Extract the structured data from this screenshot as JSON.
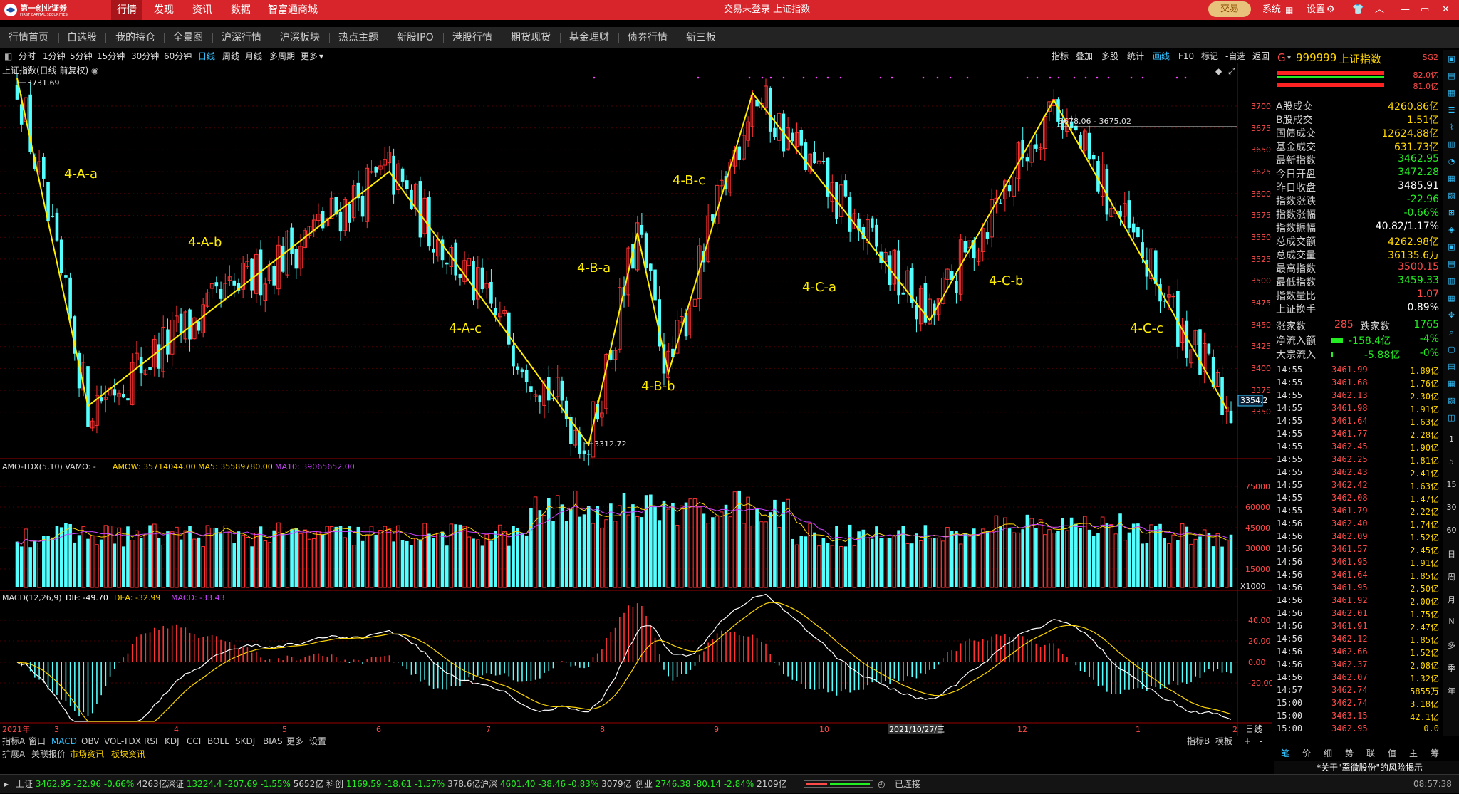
{
  "app": {
    "logo_text": "第一创业证券",
    "logo_sub": "FIRST CAPITAL SECURITIES",
    "menu": [
      "行情",
      "发现",
      "资讯",
      "数据",
      "智富通商城"
    ],
    "active_menu": "行情",
    "title": "交易未登录   上证指数",
    "trade_btn": "交易",
    "right_menu": [
      "系统",
      "设置"
    ]
  },
  "nav": [
    "行情首页",
    "自选股",
    "我的持仓",
    "全景图",
    "沪深行情",
    "沪深板块",
    "热点主题",
    "新股IPO",
    "港股行情",
    "期货现货",
    "基金理财",
    "债券行情",
    "新三板"
  ],
  "periods": [
    "分时",
    "1分钟",
    "5分钟",
    "15分钟",
    "30分钟",
    "60分钟",
    "日线",
    "周线",
    "月线",
    "多周期",
    "更多"
  ],
  "active_period": "日线",
  "tools": [
    "指标",
    "叠加",
    "多股",
    "统计",
    "画线",
    "F10",
    "标记",
    "-自选",
    "返回"
  ],
  "active_tool": "画线",
  "chart_title": "上证指数(日线 前复权)",
  "price_axis": [
    "3700",
    "3675",
    "3650",
    "3625",
    "3600",
    "3575",
    "3550",
    "3525",
    "3500",
    "3475",
    "3450",
    "3425",
    "3400",
    "3375",
    "3350"
  ],
  "annotations": {
    "high_label": "3731.69",
    "low_label": "3312.72",
    "ray_label": "3678.06 - 3675.02",
    "last_label": "3354.2"
  },
  "waves": [
    "4-A-a",
    "4-A-b",
    "4-A-c",
    "4-B-a",
    "4-B-b",
    "4-B-c",
    "4-C-a",
    "4-C-b",
    "4-C-c"
  ],
  "vol_header": {
    "name": "AMO-TDX(5,10) VAMO: -",
    "amow": "AMOW: 35714044.00",
    "ma5": "MA5: 35589780.00",
    "ma10": "MA10: 39065652.00"
  },
  "vol_axis": [
    "75000",
    "60000",
    "45000",
    "30000",
    "15000"
  ],
  "vol_unit": "X1000",
  "macd_header": {
    "name": "MACD(12,26,9)",
    "dif": "DIF: -49.70",
    "dea": "DEA: -32.99",
    "macd": "MACD: -33.43"
  },
  "macd_axis": [
    "40.00",
    "20.00",
    "0.00",
    "-20.00"
  ],
  "time_axis": [
    "2021年",
    "3",
    "4",
    "5",
    "6",
    "7",
    "8",
    "9",
    "10",
    "2021/10/27/三",
    "12",
    "1",
    "2"
  ],
  "cycle": "日线",
  "indicator_tabs": [
    "指标A",
    "窗口",
    "MACD",
    "OBV",
    "VOL-TDX",
    "RSI",
    "KDJ",
    "CCI",
    "BOLL",
    "SKDJ",
    "BIAS",
    "更多",
    "设置"
  ],
  "active_indicator": "MACD",
  "ext_tabs": [
    "扩展A",
    "关联报价",
    "市场资讯",
    "板块资讯"
  ],
  "bottom_right_tabs": [
    "指标B",
    "模板",
    "+",
    "-"
  ],
  "rpanel": {
    "code": "999999",
    "name": "上证指数",
    "flag": "SG2",
    "bars": [
      "82.0亿",
      "81.0亿"
    ],
    "rows": [
      {
        "label": "A股成交",
        "value": "4260.86亿",
        "color": "#ffd700"
      },
      {
        "label": "B股成交",
        "value": "1.51亿",
        "color": "#ffd700"
      },
      {
        "label": "国债成交",
        "value": "12624.88亿",
        "color": "#ffd700"
      },
      {
        "label": "基金成交",
        "value": "631.73亿",
        "color": "#ffd700"
      },
      {
        "label": "最新指数",
        "value": "3462.95",
        "color": "#22ee22"
      },
      {
        "label": "今日开盘",
        "value": "3472.28",
        "color": "#22ee22"
      },
      {
        "label": "昨日收盘",
        "value": "3485.91",
        "color": "#ffffff"
      },
      {
        "label": "指数涨跌",
        "value": "-22.96",
        "color": "#22ee22"
      },
      {
        "label": "指数涨幅",
        "value": "-0.66%",
        "color": "#22ee22"
      },
      {
        "label": "指数振幅",
        "value": "40.82/1.17%",
        "color": "#ffffff"
      },
      {
        "label": "总成交额",
        "value": "4262.98亿",
        "color": "#ffd700"
      },
      {
        "label": "总成交量",
        "value": "36135.6万",
        "color": "#ffd700"
      },
      {
        "label": "最高指数",
        "value": "3500.15",
        "color": "#ff4a4a"
      },
      {
        "label": "最低指数",
        "value": "3459.33",
        "color": "#22ee22"
      },
      {
        "label": "指数量比",
        "value": "1.07",
        "color": "#ff4a4a"
      },
      {
        "label": "上证换手",
        "value": "0.89%",
        "color": "#ffffff"
      }
    ],
    "up_label": "涨家数",
    "up_count": "285",
    "down_label": "跌家数",
    "down_count": "1765",
    "inflow_label": "净流入额",
    "inflow_value": "-158.4亿",
    "inflow_pct": "-4%",
    "block_label": "大宗流入",
    "block_value": "-5.88亿",
    "block_pct": "-0%",
    "ticks": [
      {
        "t": "14:55",
        "p": "3461.99",
        "v": "1.89亿"
      },
      {
        "t": "14:55",
        "p": "3461.68",
        "v": "1.76亿"
      },
      {
        "t": "14:55",
        "p": "3462.13",
        "v": "2.30亿"
      },
      {
        "t": "14:55",
        "p": "3461.98",
        "v": "1.91亿"
      },
      {
        "t": "14:55",
        "p": "3461.64",
        "v": "1.63亿"
      },
      {
        "t": "14:55",
        "p": "3461.77",
        "v": "2.28亿"
      },
      {
        "t": "14:55",
        "p": "3462.45",
        "v": "1.90亿"
      },
      {
        "t": "14:55",
        "p": "3462.25",
        "v": "1.81亿"
      },
      {
        "t": "14:55",
        "p": "3462.43",
        "v": "2.41亿"
      },
      {
        "t": "14:55",
        "p": "3462.42",
        "v": "1.63亿"
      },
      {
        "t": "14:55",
        "p": "3462.08",
        "v": "1.47亿"
      },
      {
        "t": "14:55",
        "p": "3461.79",
        "v": "2.22亿"
      },
      {
        "t": "14:56",
        "p": "3462.40",
        "v": "1.74亿"
      },
      {
        "t": "14:56",
        "p": "3462.09",
        "v": "1.52亿"
      },
      {
        "t": "14:56",
        "p": "3461.57",
        "v": "2.45亿"
      },
      {
        "t": "14:56",
        "p": "3461.95",
        "v": "1.91亿"
      },
      {
        "t": "14:56",
        "p": "3461.64",
        "v": "1.85亿"
      },
      {
        "t": "14:56",
        "p": "3461.95",
        "v": "2.50亿"
      },
      {
        "t": "14:56",
        "p": "3461.92",
        "v": "2.00亿"
      },
      {
        "t": "14:56",
        "p": "3462.01",
        "v": "1.75亿"
      },
      {
        "t": "14:56",
        "p": "3461.91",
        "v": "2.47亿"
      },
      {
        "t": "14:56",
        "p": "3462.12",
        "v": "1.85亿"
      },
      {
        "t": "14:56",
        "p": "3462.66",
        "v": "1.52亿"
      },
      {
        "t": "14:56",
        "p": "3462.37",
        "v": "2.08亿"
      },
      {
        "t": "14:56",
        "p": "3462.07",
        "v": "1.32亿"
      },
      {
        "t": "14:57",
        "p": "3462.74",
        "v": "5855万"
      },
      {
        "t": "15:00",
        "p": "3462.74",
        "v": "3.18亿"
      },
      {
        "t": "15:00",
        "p": "3463.15",
        "v": "42.1亿"
      },
      {
        "t": "15:00",
        "p": "3462.95",
        "v": "0.0"
      }
    ],
    "tabs": [
      "笔",
      "价",
      "细",
      "势",
      "联",
      "值",
      "主",
      "筹"
    ],
    "notice": "*关于\"翠微股份\"的风险揭示"
  },
  "vstrip": [
    "1",
    "5",
    "15",
    "30",
    "60",
    "日",
    "周",
    "月",
    "N",
    "多",
    "季",
    "年"
  ],
  "status": [
    {
      "name": "上证",
      "price": "3462.95",
      "chg": "-22.96",
      "pct": "-0.66%",
      "amt": "4263亿"
    },
    {
      "name": "深证",
      "price": "13224.4",
      "chg": "-207.69",
      "pct": "-1.55%",
      "amt": "5652亿"
    },
    {
      "name": "科创",
      "price": "1169.59",
      "chg": "-18.61",
      "pct": "-1.57%",
      "amt": "378.6亿"
    },
    {
      "name": "沪深",
      "price": "4601.40",
      "chg": "-38.46",
      "pct": "-0.83%",
      "amt": "3079亿"
    },
    {
      "name": "创业",
      "price": "2746.38",
      "chg": "-80.14",
      "pct": "-2.84%",
      "amt": "2109亿"
    }
  ],
  "conn_status": "已连接",
  "clock": "08:57:38"
}
